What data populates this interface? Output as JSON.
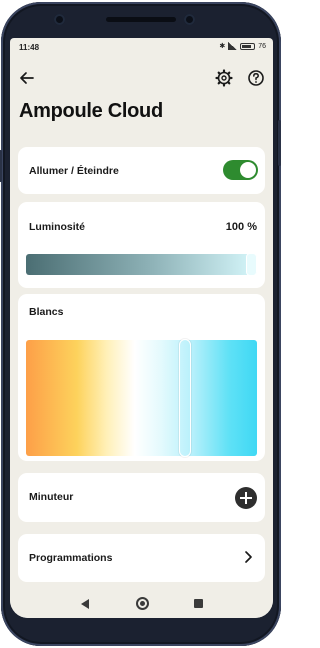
{
  "status": {
    "time": "11:48",
    "battery": "76"
  },
  "header": {
    "title": "Ampoule Cloud"
  },
  "power": {
    "label": "Allumer / Éteindre",
    "on": true
  },
  "brightness": {
    "label": "Luminosité",
    "value_text": "100 %",
    "level": 1.0
  },
  "whites": {
    "label": "Blancs",
    "level": 0.7
  },
  "timer": {
    "label": "Minuteur"
  },
  "schedules": {
    "label": "Programmations"
  },
  "colors": {
    "accent": "#2e8b2f",
    "background": "#f0eee7",
    "card": "#ffffff"
  }
}
